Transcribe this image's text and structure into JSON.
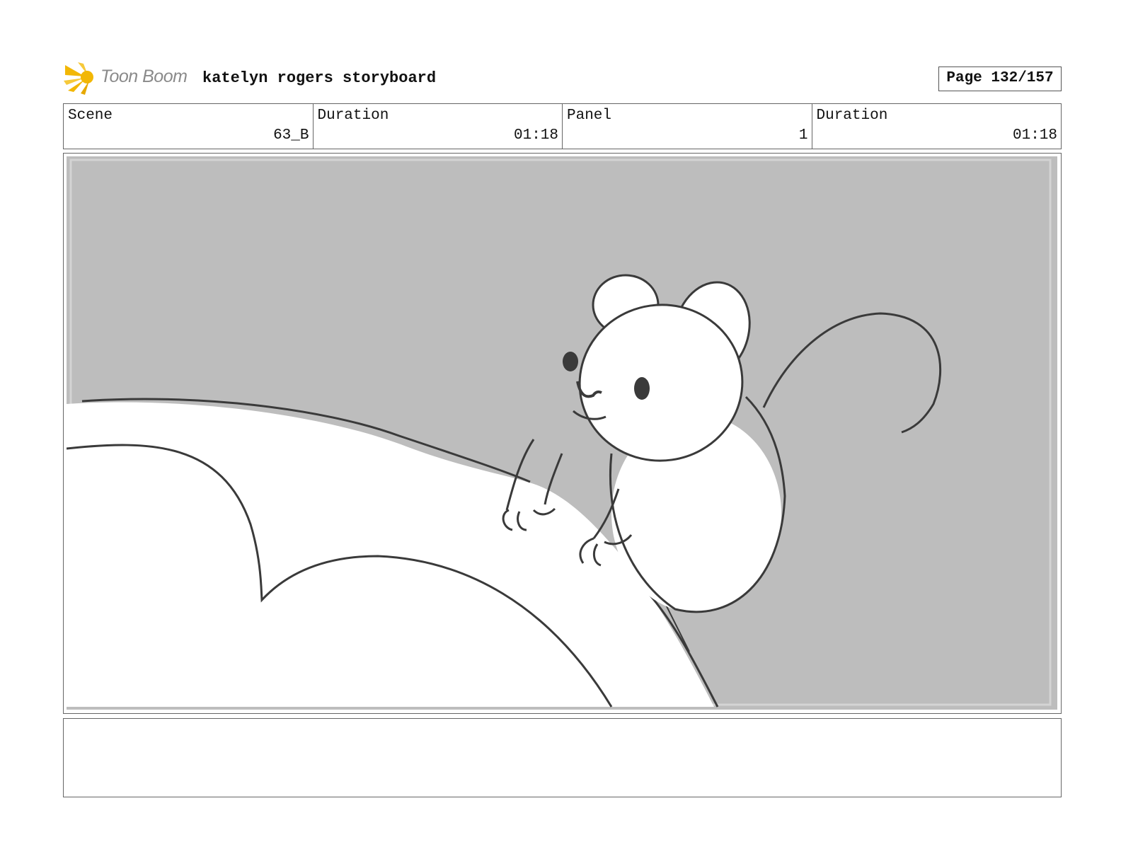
{
  "header": {
    "logo_text": "Toon Boom",
    "project_title": "katelyn rogers storyboard",
    "page_label": "Page 132/157"
  },
  "info": [
    {
      "label": "Scene",
      "value": "63_B"
    },
    {
      "label": "Duration",
      "value": "01:18"
    },
    {
      "label": "Panel",
      "value": "1"
    },
    {
      "label": "Duration",
      "value": "01:18"
    }
  ],
  "notes": {
    "text": ""
  },
  "colors": {
    "logo_accent": "#f2b705",
    "panel_background": "#bdbdbd",
    "sketch_line": "#3a3a3a"
  }
}
